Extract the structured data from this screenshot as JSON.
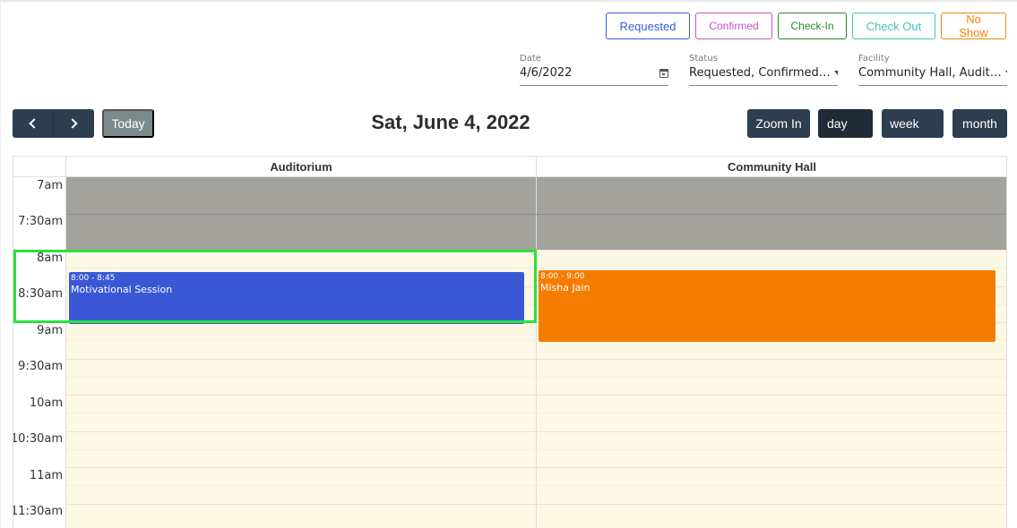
{
  "legend": {
    "requested": "Requested",
    "confirmed": "Confirmed",
    "checkin": "Check-In",
    "checkout": "Check Out",
    "noshow": "No Show"
  },
  "filters": {
    "date": {
      "label": "Date",
      "value": "4/6/2022"
    },
    "status": {
      "label": "Status",
      "value": "Requested, Confirmed…"
    },
    "facility": {
      "label": "Facility",
      "value": "Community Hall, Audit…"
    }
  },
  "toolbar": {
    "today": "Today",
    "title": "Sat, June 4, 2022",
    "zoom_in": "Zoom In",
    "views": {
      "day": "day",
      "week": "week",
      "month": "month"
    }
  },
  "calendar": {
    "resources": [
      "Auditorium",
      "Community Hall"
    ],
    "time_slots": [
      "7am",
      "7:30am",
      "8am",
      "8:30am",
      "9am",
      "9:30am",
      "10am",
      "10:30am",
      "11am",
      "11:30am"
    ],
    "events": [
      {
        "resource": "Auditorium",
        "time": "8:00 - 8:45",
        "title": "Motivational Session",
        "color": "#3a58d6"
      },
      {
        "resource": "Community Hall",
        "time": "8:00 - 9:00",
        "title": "Misha Jain",
        "color": "#f57c00"
      }
    ]
  },
  "colors": {
    "requested": "#3a5bd9",
    "confirmed": "#c455c4",
    "checkin": "#2a8a2a",
    "checkout": "#44c3b6",
    "noshow": "#f0840c",
    "closed_hours": "#a3a29d",
    "open_hours": "#fdf8e3",
    "focus_highlight": "#28e33c"
  }
}
